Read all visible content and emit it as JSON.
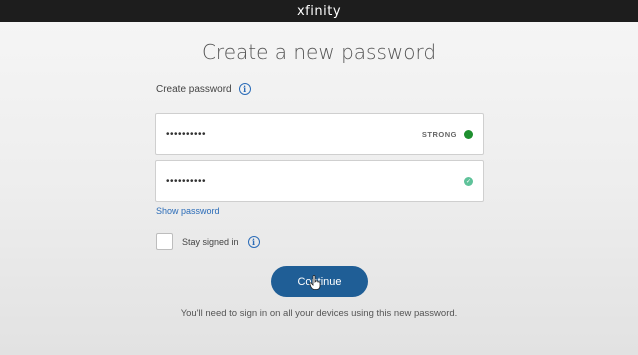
{
  "header": {
    "logo_text": "xfinity"
  },
  "page": {
    "title": "Create a new password"
  },
  "form": {
    "create_label": "Create password",
    "password_value": "••••••••••",
    "strength_text": "STRONG",
    "confirm_value": "••••••••••",
    "show_password_label": "Show password",
    "stay_signed_in_label": "Stay signed in",
    "stay_signed_in_checked": false,
    "continue_label": "Continue",
    "note": "You'll need to sign in on all your devices using this new password."
  },
  "colors": {
    "topbar": "#1d1d1d",
    "accent": "#2b6cb8",
    "button": "#1f5e96",
    "strong_indicator": "#1e8f2f",
    "match_indicator": "#5fc29a"
  },
  "icons": {
    "info": "info-icon",
    "status": "status-dot-icon",
    "check": "check-icon",
    "cursor": "hand-pointer-icon"
  }
}
